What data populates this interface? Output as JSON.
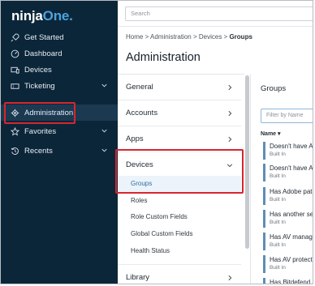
{
  "logo": {
    "text_main": "ninja",
    "text_accent": "One",
    "suffix": "."
  },
  "sidebar": {
    "items": [
      {
        "label": "Get Started",
        "icon": "rocket-icon"
      },
      {
        "label": "Dashboard",
        "icon": "gauge-icon"
      },
      {
        "label": "Devices",
        "icon": "devices-icon"
      },
      {
        "label": "Ticketing",
        "icon": "ticket-icon",
        "has_chevron": true
      },
      {
        "label": "Administration",
        "icon": "gear-icon",
        "active": true
      },
      {
        "label": "Favorites",
        "icon": "star-icon",
        "has_chevron": true
      },
      {
        "label": "Recents",
        "icon": "history-icon",
        "has_chevron": true
      }
    ]
  },
  "search": {
    "placeholder": "Search"
  },
  "breadcrumb": {
    "home": "Home",
    "sep": ">",
    "admin": "Administration",
    "devices": "Devices",
    "current": "Groups"
  },
  "page_title": "Administration",
  "sections": [
    {
      "label": "General",
      "expanded": false
    },
    {
      "label": "Accounts",
      "expanded": false
    },
    {
      "label": "Apps",
      "expanded": false
    },
    {
      "label": "Devices",
      "expanded": true
    },
    {
      "label": "Library",
      "expanded": false
    }
  ],
  "devices_subitems": [
    {
      "label": "Groups",
      "active": true
    },
    {
      "label": "Roles"
    },
    {
      "label": "Role Custom Fields"
    },
    {
      "label": "Global Custom Fields"
    },
    {
      "label": "Health Status"
    }
  ],
  "groups_panel": {
    "title": "Groups",
    "filter_placeholder": "Filter by Name",
    "column_header": "Name",
    "rows": [
      {
        "name": "Doesn't have A",
        "sub": "Built In"
      },
      {
        "name": "Doesn't have A",
        "sub": "Built In"
      },
      {
        "name": "Has Adobe pat",
        "sub": "Built In"
      },
      {
        "name": "Has another se",
        "sub": "Built In"
      },
      {
        "name": "Has AV manag",
        "sub": "Built In"
      },
      {
        "name": "Has AV protect",
        "sub": "Built In"
      },
      {
        "name": "Has Bitdefend",
        "sub": ""
      }
    ]
  },
  "colors": {
    "sidebar_bg": "#0c2639",
    "accent": "#4aa3df",
    "highlight": "#d7262e",
    "active_sub_bg": "#ecf3fa",
    "group_bar": "#5e8db6"
  }
}
